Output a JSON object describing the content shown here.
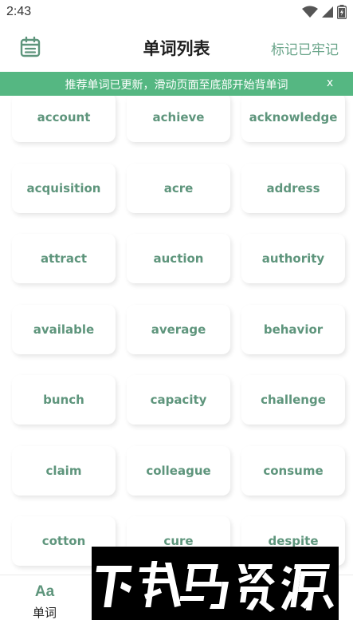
{
  "status_bar": {
    "time": "2:43",
    "icons": [
      "wifi-icon",
      "signal-icon",
      "battery-icon"
    ]
  },
  "header": {
    "calendar_icon": "calendar-icon",
    "title": "单词列表",
    "mark_button": "标记已牢记"
  },
  "notice": {
    "text": "推荐单词已更新，滑动页面至底部开始背单词",
    "close": "x"
  },
  "words": [
    [
      "account",
      "achieve",
      "acknowledge"
    ],
    [
      "acquisition",
      "acre",
      "address"
    ],
    [
      "attract",
      "auction",
      "authority"
    ],
    [
      "available",
      "average",
      "behavior"
    ],
    [
      "bunch",
      "capacity",
      "challenge"
    ],
    [
      "claim",
      "colleague",
      "consume"
    ],
    [
      "cotton",
      "cure",
      "despite"
    ]
  ],
  "bottom_nav": {
    "words_icon": "Aa",
    "words_label": "单词"
  },
  "watermark": {
    "text": "下载鸟资源"
  },
  "colors": {
    "accent": "#55b782",
    "word_text": "#5e957c",
    "mark_text": "#6aa58a"
  }
}
